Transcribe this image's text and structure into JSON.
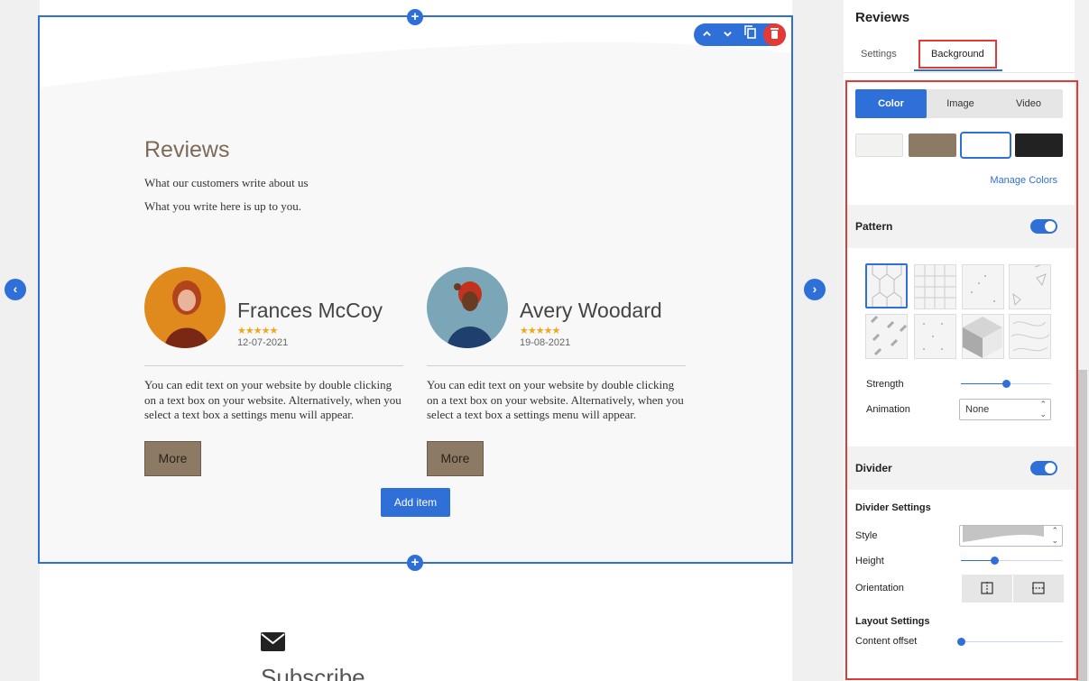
{
  "canvas": {
    "section": {
      "title": "Reviews",
      "subtitle": "What our customers write about us",
      "description": "What you write here is up to you.",
      "reviews": [
        {
          "name": "Frances McCoy",
          "stars": "★★★★★",
          "rating": 5,
          "date": "12-07-2021",
          "text": "You can edit text on your website by double clicking on a text box on your website. Alternatively, when you select a text box a settings menu will appear.",
          "button": "More"
        },
        {
          "name": "Avery Woodard",
          "stars": "★★★★★",
          "rating": 5,
          "date": "19-08-2021",
          "text": "You can edit text on your website by double clicking on a text box on your website. Alternatively, when you select a text box a settings menu will appear.",
          "button": "More"
        }
      ],
      "add_item_label": "Add item"
    },
    "next_section_title": "Subscribe",
    "icons": {
      "add_top": "plus-icon",
      "add_bottom": "plus-icon",
      "prev": "chevron-left-icon",
      "next": "chevron-right-icon",
      "move_up": "chevron-up-icon",
      "move_down": "chevron-down-icon",
      "duplicate": "copy-icon",
      "delete": "trash-icon",
      "envelope": "envelope-icon"
    }
  },
  "panel": {
    "title": "Reviews",
    "tabs": [
      {
        "label": "Settings",
        "active": false
      },
      {
        "label": "Background",
        "active": true
      }
    ],
    "background_types": [
      {
        "label": "Color",
        "active": true
      },
      {
        "label": "Image",
        "active": false
      },
      {
        "label": "Video",
        "active": false
      }
    ],
    "swatches": [
      "#f2f2f0",
      "#8d7a64",
      "#ffffff",
      "#222222"
    ],
    "selected_swatch": "#ffffff",
    "manage_colors_label": "Manage Colors",
    "pattern": {
      "label": "Pattern",
      "enabled": true,
      "strength_label": "Strength",
      "strength_value": 0.5,
      "animation_label": "Animation",
      "animation_value": "None"
    },
    "divider": {
      "label": "Divider",
      "enabled": true,
      "settings_heading": "Divider Settings",
      "style_label": "Style",
      "height_label": "Height",
      "height_value": 0.3,
      "orientation_label": "Orientation",
      "layout_heading": "Layout Settings",
      "content_offset_label": "Content offset",
      "content_offset_value": 0
    }
  },
  "colors": {
    "accent": "#2f6fd8",
    "danger": "#e53935",
    "brand_brown": "#8d7a64",
    "star": "#f2a619"
  }
}
